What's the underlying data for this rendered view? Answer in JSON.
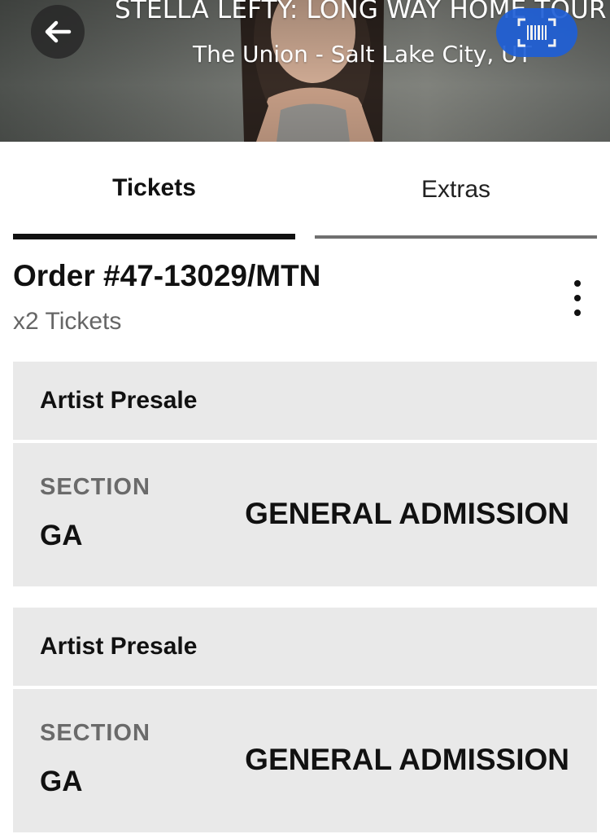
{
  "header": {
    "event_title": "STELLA LEFTY: LONG WAY HOME TOUR",
    "venue": "The Union - Salt Lake City, UT",
    "back_icon": "arrow-left-icon",
    "scan_icon": "barcode-scan-icon",
    "scan_color": "#1f5fd6"
  },
  "tabs": [
    {
      "label": "Tickets",
      "active": true
    },
    {
      "label": "Extras",
      "active": false
    }
  ],
  "order": {
    "title": "Order #47-13029/MTN",
    "ticket_count": "x2 Tickets",
    "more_icon": "more-vertical-icon"
  },
  "tickets": [
    {
      "type": "Artist Presale",
      "section_label": "SECTION",
      "section": "GA",
      "admission": "GENERAL ADMISSION"
    },
    {
      "type": "Artist Presale",
      "section_label": "SECTION",
      "section": "GA",
      "admission": "GENERAL ADMISSION"
    }
  ]
}
